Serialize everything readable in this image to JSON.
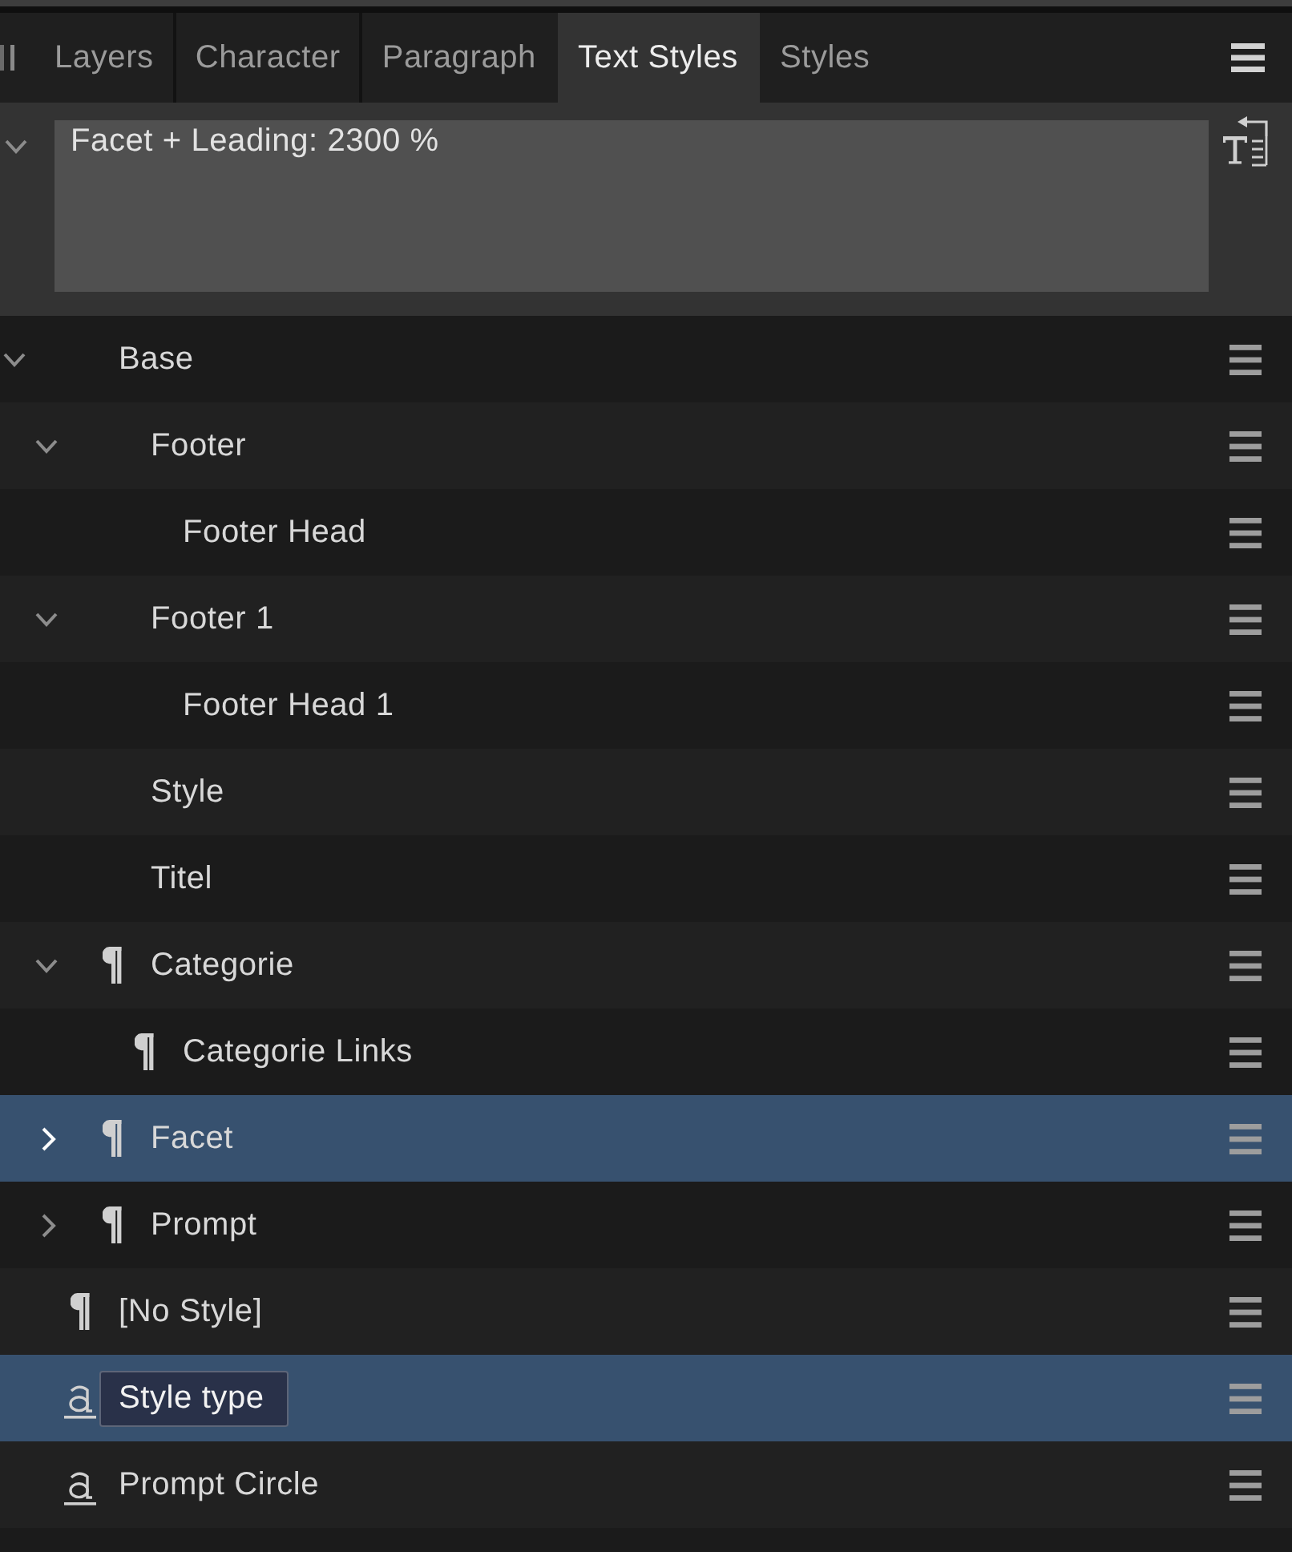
{
  "panel": {
    "tabs": [
      {
        "label": "Layers",
        "selected": false
      },
      {
        "label": "Character",
        "selected": false
      },
      {
        "label": "Paragraph",
        "selected": false
      },
      {
        "label": "Text Styles",
        "selected": true
      },
      {
        "label": "Styles",
        "selected": false
      }
    ]
  },
  "preview": {
    "expanded": true,
    "text": "Facet + Leading: 2300 %"
  },
  "styles": [
    {
      "name": "Base",
      "kind": "plain",
      "selected": false,
      "editing": false,
      "expanded": true,
      "children": [
        {
          "name": "Footer",
          "kind": "plain",
          "selected": false,
          "editing": false,
          "expanded": true,
          "children": [
            {
              "name": "Footer Head",
              "kind": "plain",
              "selected": false,
              "editing": false
            }
          ]
        },
        {
          "name": "Footer 1",
          "kind": "plain",
          "selected": false,
          "editing": false,
          "expanded": true,
          "children": [
            {
              "name": "Footer Head 1",
              "kind": "plain",
              "selected": false,
              "editing": false
            }
          ]
        },
        {
          "name": "Style",
          "kind": "plain",
          "selected": false,
          "editing": false
        },
        {
          "name": "Titel",
          "kind": "plain",
          "selected": false,
          "editing": false
        },
        {
          "name": "Categorie",
          "kind": "paragraph",
          "selected": false,
          "editing": false,
          "expanded": true,
          "children": [
            {
              "name": "Categorie Links",
              "kind": "paragraph",
              "selected": false,
              "editing": false
            }
          ]
        },
        {
          "name": "Facet",
          "kind": "paragraph",
          "selected": true,
          "editing": false,
          "expanded": false
        },
        {
          "name": "Prompt",
          "kind": "paragraph",
          "selected": false,
          "editing": false,
          "expanded": false
        }
      ]
    },
    {
      "name": "[No Style]",
      "kind": "paragraph",
      "selected": false,
      "editing": false
    },
    {
      "name": "Style type",
      "kind": "character",
      "selected": true,
      "editing": true
    },
    {
      "name": "Prompt Circle",
      "kind": "character",
      "selected": false,
      "editing": false
    }
  ]
}
